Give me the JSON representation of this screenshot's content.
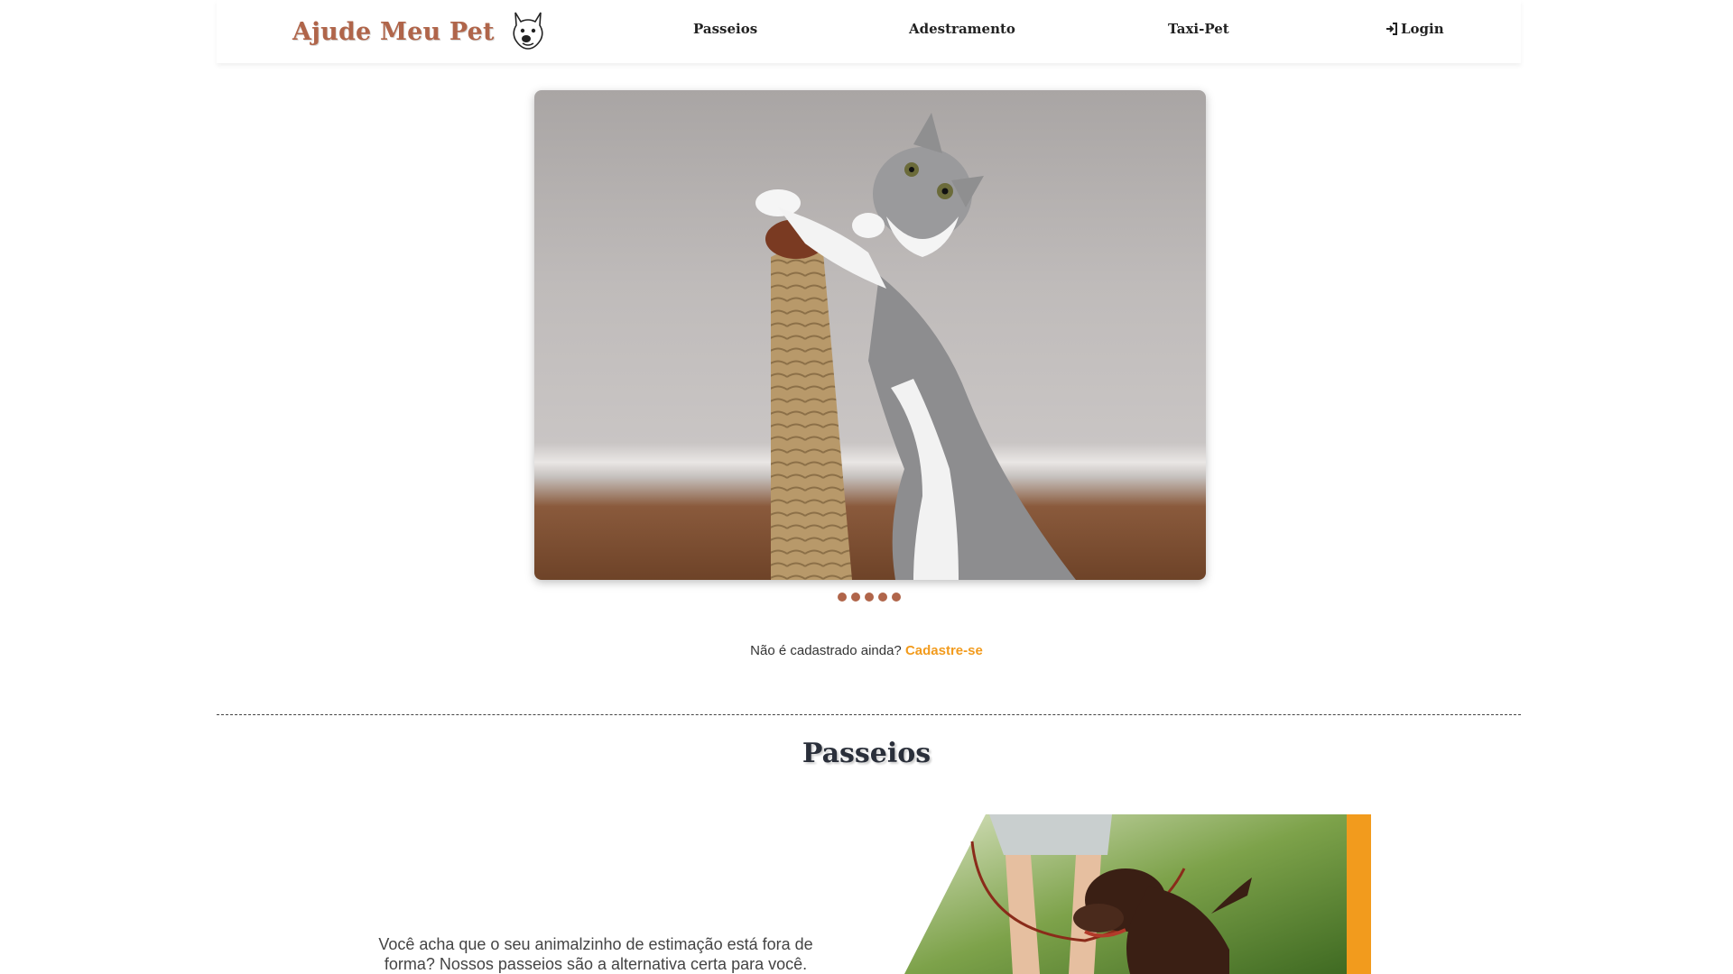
{
  "header": {
    "logo_text": "Ajude Meu Pet",
    "logo_icon": "dog-face-icon",
    "nav": {
      "passeios": "Passeios",
      "adestramento": "Adestramento",
      "taxi_pet": "Taxi-Pet",
      "login": "Login"
    },
    "login_icon": "sign-in-icon"
  },
  "carousel": {
    "slide_count": 5,
    "active_index": 0
  },
  "signup": {
    "prompt": "Não é cadastrado ainda?",
    "link": "Cadastre-se"
  },
  "section": {
    "title": "Passeios",
    "text": "Você acha que o seu animalzinho de estimação está fora de forma? Nossos passeios são a alternativa certa para você."
  },
  "colors": {
    "brand": "#b0654a",
    "accent": "#f29b1d",
    "title": "#2a2f3a"
  }
}
